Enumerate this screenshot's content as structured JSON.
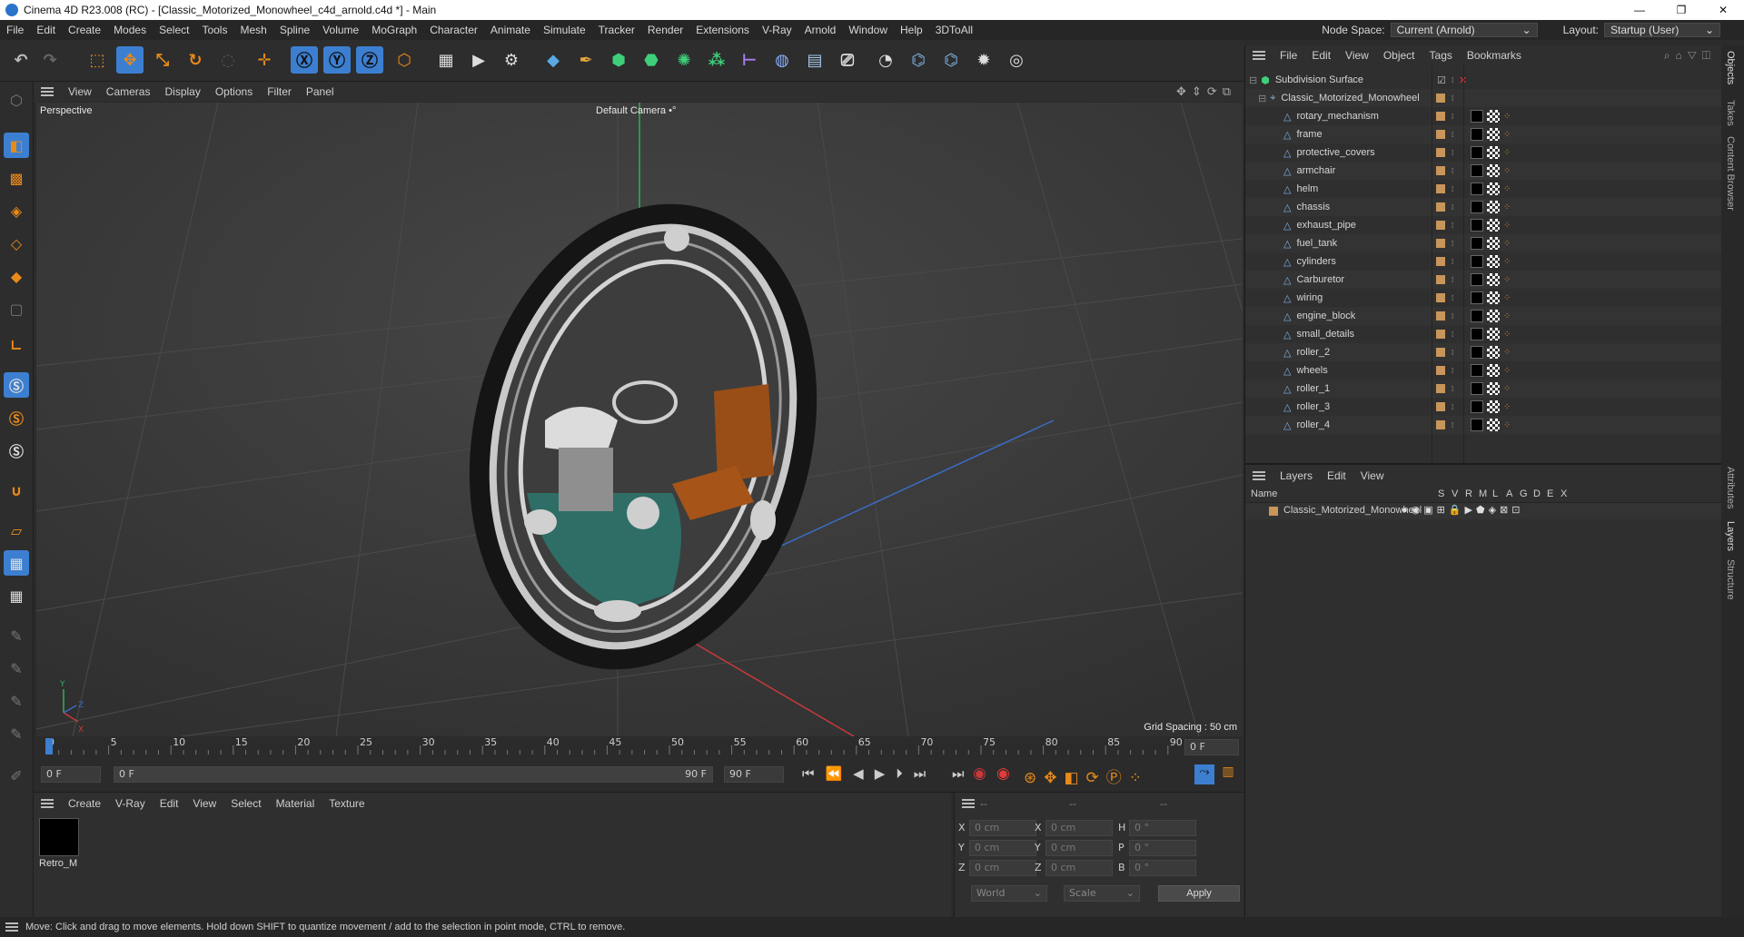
{
  "window": {
    "title": "Cinema 4D R23.008 (RC) - [Classic_Motorized_Monowheel_c4d_arnold.c4d *] - Main",
    "controls": [
      "—",
      "❐",
      "✕"
    ]
  },
  "menubar": {
    "items": [
      "File",
      "Edit",
      "Create",
      "Modes",
      "Select",
      "Tools",
      "Mesh",
      "Spline",
      "Volume",
      "MoGraph",
      "Character",
      "Animate",
      "Simulate",
      "Tracker",
      "Render",
      "Extensions",
      "V-Ray",
      "Arnold",
      "Window",
      "Help",
      "3DToAll"
    ],
    "node_space_label": "Node Space:",
    "node_space_value": "Current (Arnold)",
    "layout_label": "Layout:",
    "layout_value": "Startup (User)"
  },
  "viewport": {
    "menu": [
      "View",
      "Cameras",
      "Display",
      "Options",
      "Filter",
      "Panel"
    ],
    "projection": "Perspective",
    "camera": "Default Camera",
    "grid_spacing": "Grid Spacing : 50 cm",
    "axis_labels": {
      "x": "X",
      "y": "Y",
      "z": "Z"
    }
  },
  "timeline": {
    "ticks": [
      "0",
      "5",
      "10",
      "15",
      "20",
      "25",
      "30",
      "35",
      "40",
      "45",
      "50",
      "55",
      "60",
      "65",
      "70",
      "75",
      "80",
      "85",
      "90"
    ],
    "current_frame_field": "0 F",
    "start_field": "0 F",
    "range_start": "0 F",
    "range_end": "90 F",
    "end_field": "90 F"
  },
  "material_panel": {
    "menu": [
      "Create",
      "V-Ray",
      "Edit",
      "View",
      "Select",
      "Material",
      "Texture"
    ],
    "materials": [
      {
        "name": "Retro_M",
        "color": "#000000"
      }
    ]
  },
  "coordinates": {
    "headers": [
      "--",
      "--",
      "--"
    ],
    "rows": [
      {
        "a": "X",
        "av": "0 cm",
        "b": "X",
        "bv": "0 cm",
        "c": "H",
        "cv": "0 °"
      },
      {
        "a": "Y",
        "av": "0 cm",
        "b": "Y",
        "bv": "0 cm",
        "c": "P",
        "cv": "0 °"
      },
      {
        "a": "Z",
        "av": "0 cm",
        "b": "Z",
        "bv": "0 cm",
        "c": "B",
        "cv": "0 °"
      }
    ],
    "mode1": "World",
    "mode2": "Scale",
    "apply": "Apply"
  },
  "status": {
    "text": "Move: Click and drag to move elements. Hold down SHIFT to quantize movement / add to the selection in point mode, CTRL to remove."
  },
  "objects_panel": {
    "menu": [
      "File",
      "Edit",
      "View",
      "Object",
      "Tags",
      "Bookmarks"
    ],
    "root": "Subdivision Surface",
    "group": "Classic_Motorized_Monowheel",
    "children": [
      "rotary_mechanism",
      "frame",
      "protective_covers",
      "armchair",
      "helm",
      "chassis",
      "exhaust_pipe",
      "fuel_tank",
      "cylinders",
      "Carburetor",
      "wiring",
      "engine_block",
      "small_details",
      "roller_2",
      "wheels",
      "roller_1",
      "roller_3",
      "roller_4"
    ]
  },
  "layers_panel": {
    "menu": [
      "Layers",
      "Edit",
      "View"
    ],
    "columns": [
      "Name",
      "S",
      "V",
      "R",
      "M",
      "L",
      "A",
      "G",
      "D",
      "E",
      "X"
    ],
    "layers": [
      {
        "name": "Classic_Motorized_Monowheel",
        "color": "#c8955a"
      }
    ]
  },
  "side_tabs": [
    "Objects",
    "Takes",
    "Content Browser",
    "Attributes",
    "Layers",
    "Structure"
  ],
  "colors": {
    "accent_blue": "#3c7fd1",
    "layer_orange": "#c8955a",
    "tile_orange": "#e88a1a"
  }
}
